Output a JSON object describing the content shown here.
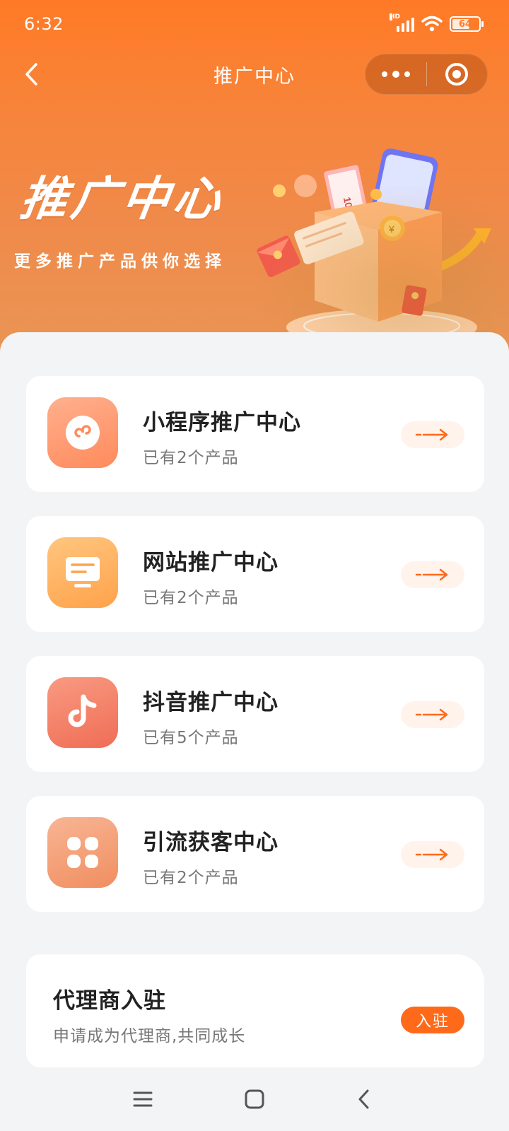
{
  "status_bar": {
    "time": "6:32",
    "network": "HD",
    "battery": "64"
  },
  "nav": {
    "title": "推广中心"
  },
  "banner": {
    "title": "推广中心",
    "subtitle": "更多推广产品供你选择",
    "illustration_money_label": "100",
    "coin_symbol": "¥"
  },
  "cards": [
    {
      "title": "小程序推广中心",
      "subtitle": "已有2个产品",
      "icon": "mini-program-icon",
      "color": "#ff9d70"
    },
    {
      "title": "网站推广中心",
      "subtitle": "已有2个产品",
      "icon": "website-monitor-icon",
      "color": "#ffb15f"
    },
    {
      "title": "抖音推广中心",
      "subtitle": "已有5个产品",
      "icon": "douyin-icon",
      "color": "#f7826b"
    },
    {
      "title": "引流获客中心",
      "subtitle": "已有2个产品",
      "icon": "apps-grid-icon",
      "color": "#f3a075"
    }
  ],
  "agent": {
    "title": "代理商入驻",
    "subtitle": "申请成为代理商,共同成长",
    "button": "入驻"
  },
  "colors": {
    "primary": "#ff7a26",
    "accent_button": "#ff6a1a",
    "page_bg": "#f3f4f6"
  }
}
